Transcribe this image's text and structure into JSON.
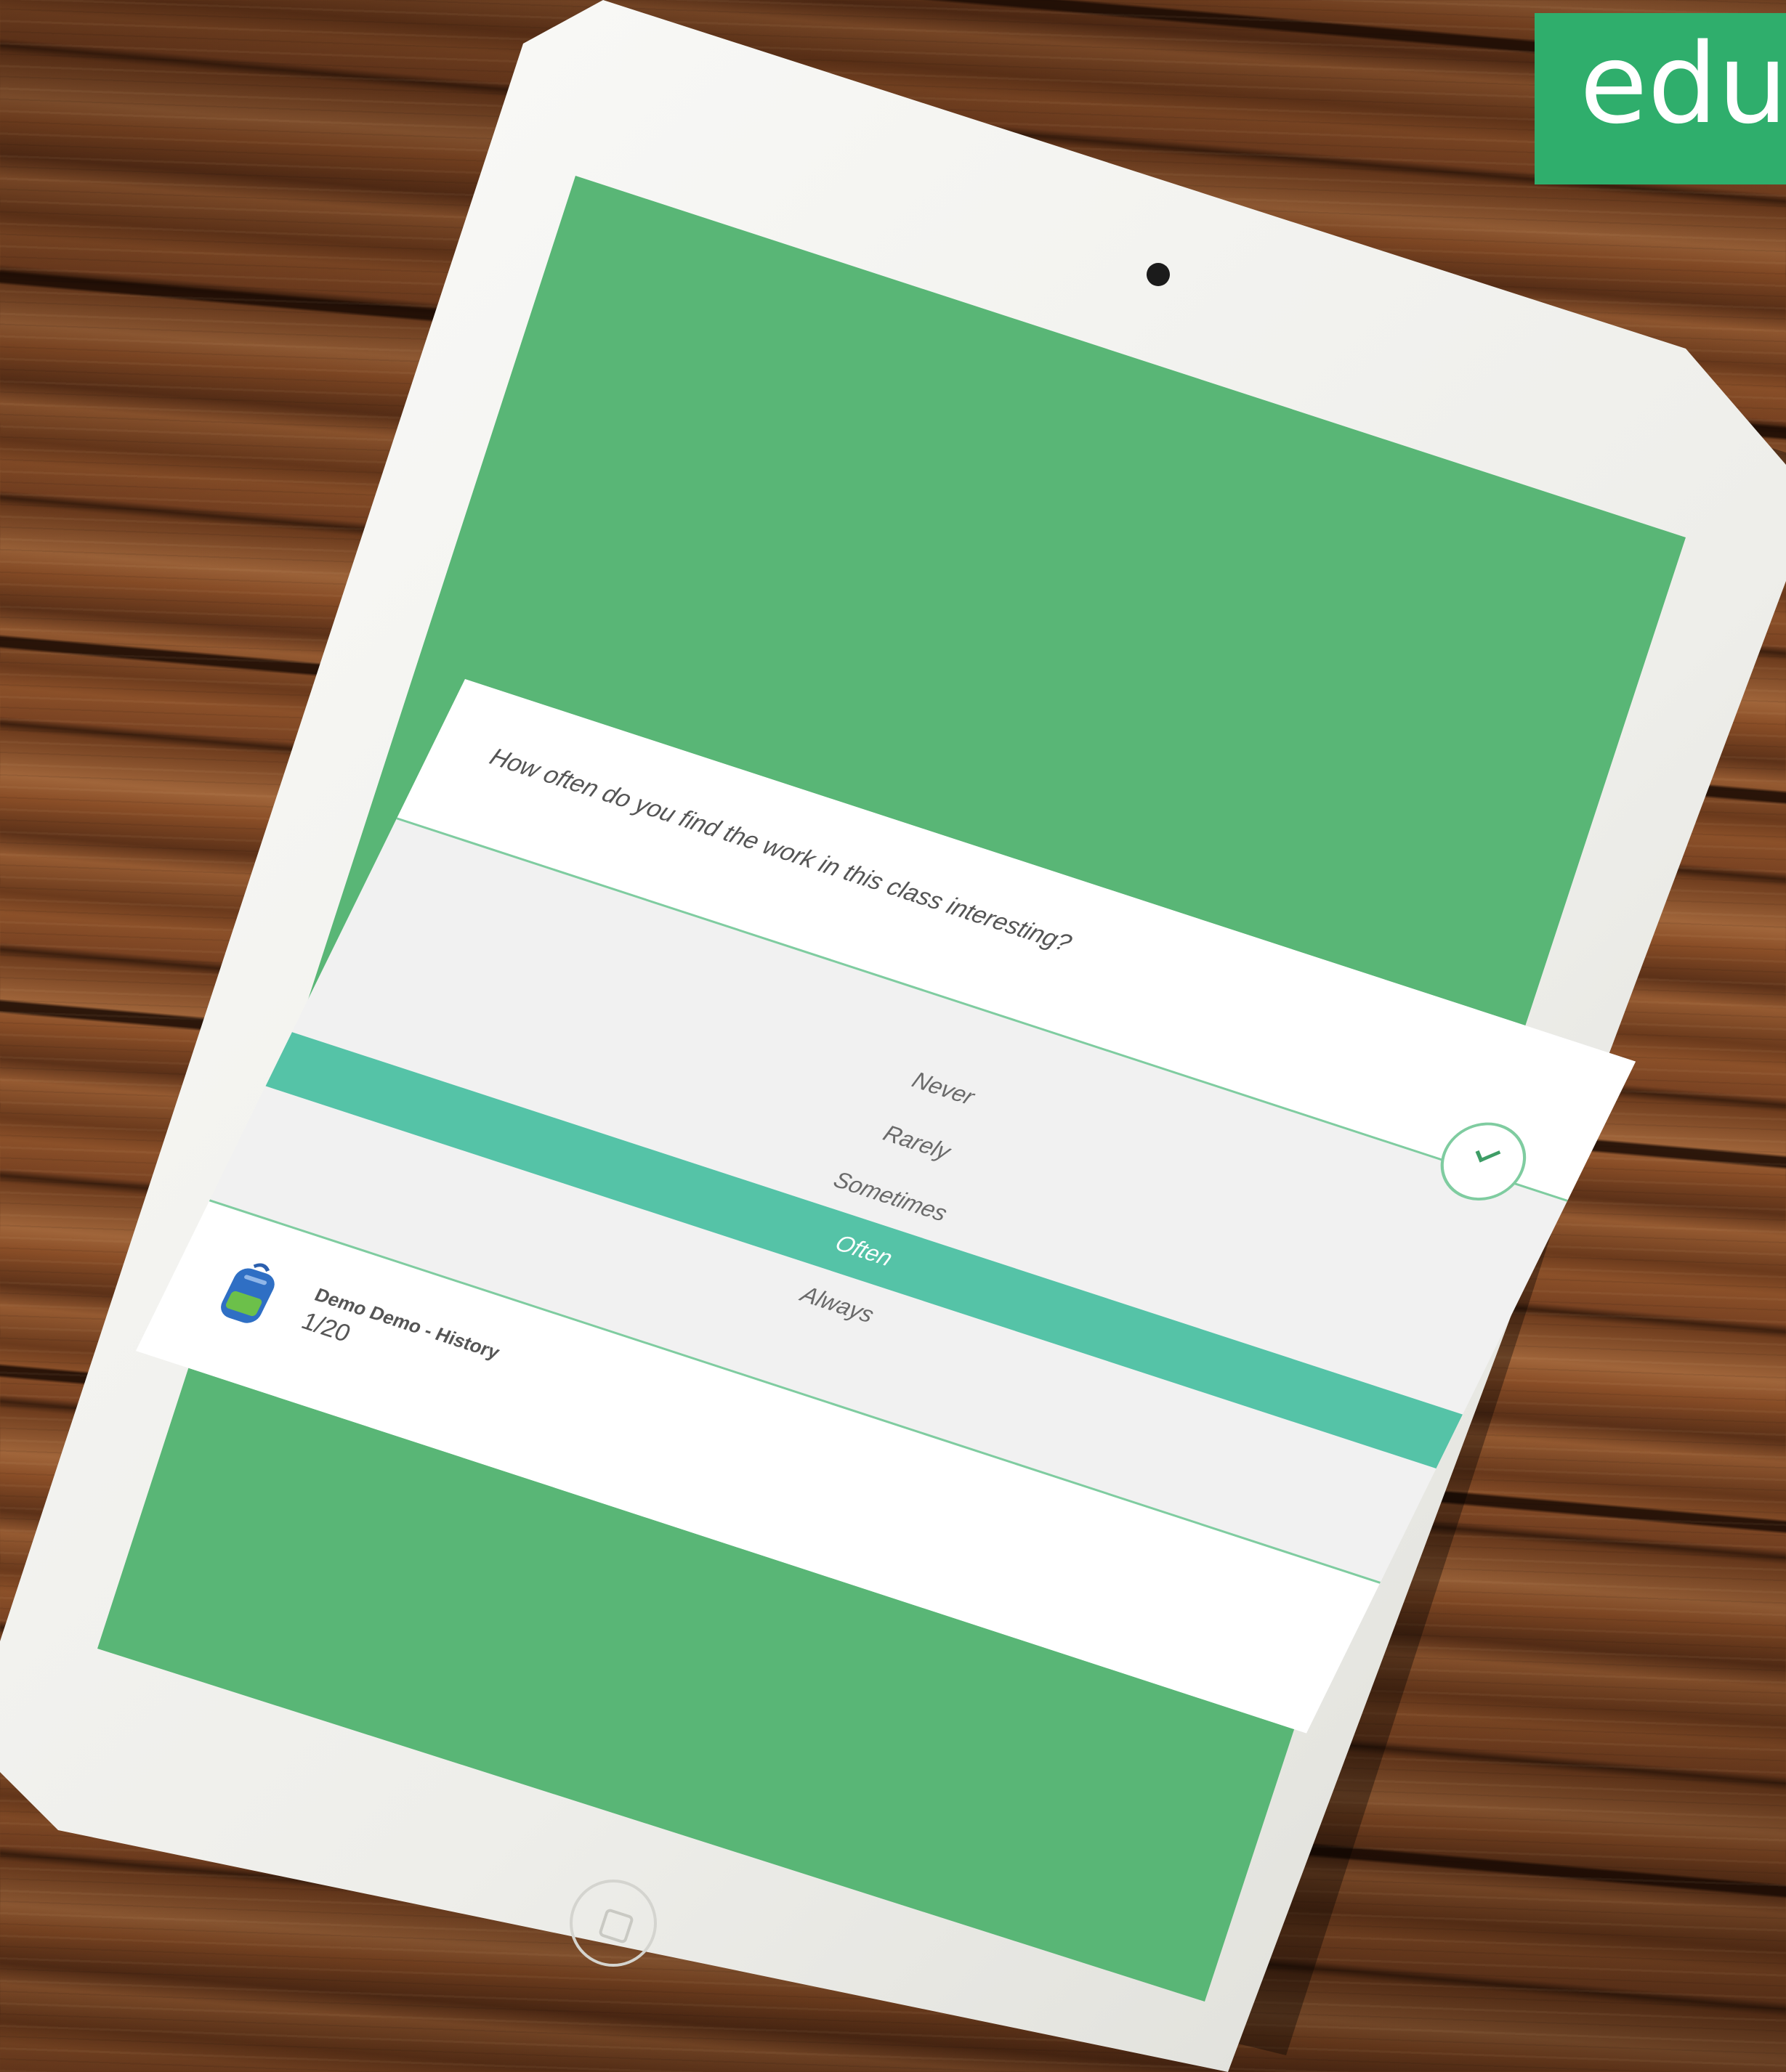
{
  "brand": {
    "text": "edur",
    "color": "#2fae6c"
  },
  "survey": {
    "question": "How often do you find the work in this class interesting?",
    "options": [
      {
        "label": "Never",
        "selected": false
      },
      {
        "label": "Rarely",
        "selected": false
      },
      {
        "label": "Sometimes",
        "selected": false
      },
      {
        "label": "Often",
        "selected": true
      },
      {
        "label": "Always",
        "selected": false
      }
    ],
    "selected_color": "#55c3a7",
    "submit_icon": "checkmark-icon"
  },
  "footer": {
    "icon": "backpack-icon",
    "class_name": "Demo Demo - History",
    "progress": "1/20"
  },
  "colors": {
    "screen_background": "#59b676",
    "accent_line": "#7fcca0"
  }
}
